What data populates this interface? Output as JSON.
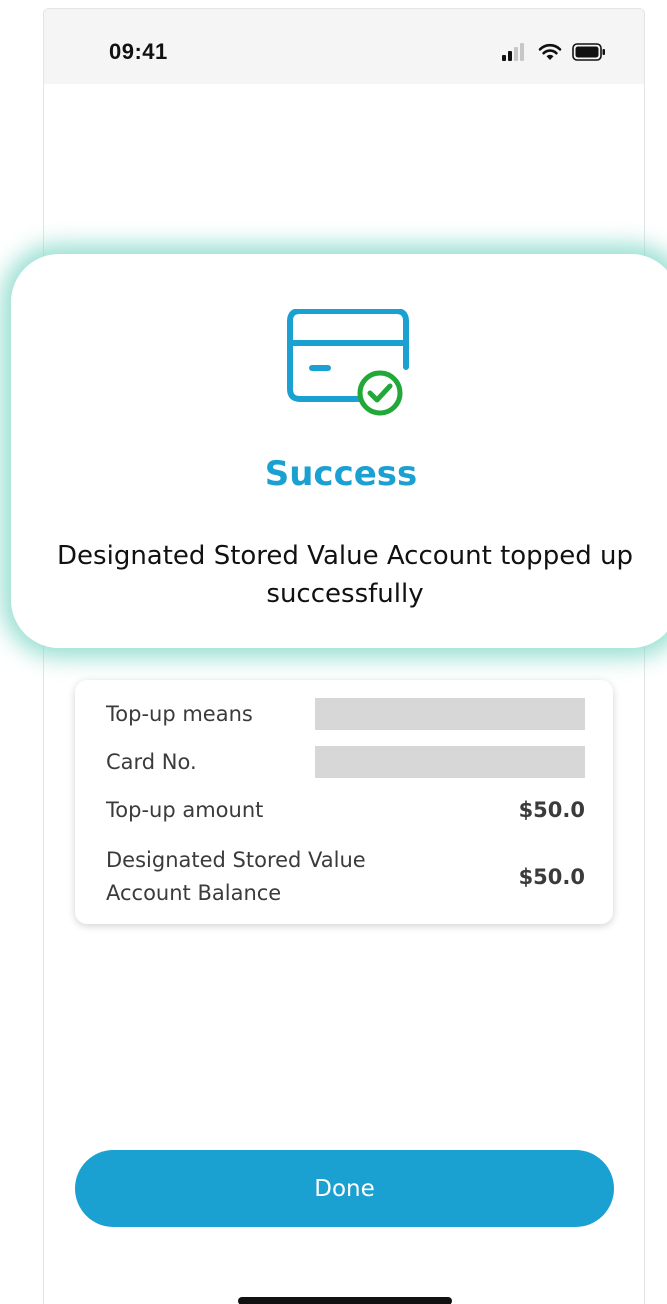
{
  "status_bar": {
    "time": "09:41"
  },
  "modal": {
    "icon": "card-check-icon",
    "title": "Success",
    "message_line1": "Designated Stored Value Account topped up",
    "message_line2": "successfully"
  },
  "details": {
    "rows": [
      {
        "label": "Top-up means",
        "value": ""
      },
      {
        "label": "Card No.",
        "value": ""
      },
      {
        "label": "Top-up amount",
        "value": "$50.0"
      },
      {
        "label_line1": "Designated Stored Value",
        "label_line2": "Account Balance",
        "value": "$50.0"
      }
    ]
  },
  "done_button": {
    "label": "Done"
  },
  "colors": {
    "accent": "#1aa1d1",
    "success": "#22a838",
    "glow": "#7ad6c4"
  }
}
